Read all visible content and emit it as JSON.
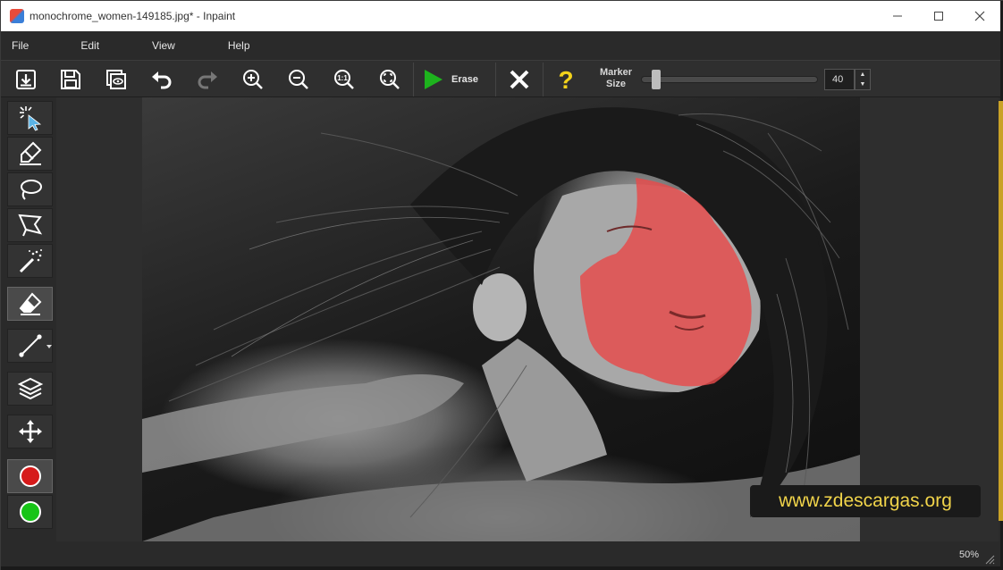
{
  "window": {
    "title": "monochrome_women-149185.jpg* - Inpaint",
    "minimize_icon": "minimize-icon",
    "maximize_icon": "maximize-icon",
    "close_icon": "close-icon"
  },
  "menu": {
    "items": [
      {
        "label": "File"
      },
      {
        "label": "Edit"
      },
      {
        "label": "View"
      },
      {
        "label": "Help"
      }
    ]
  },
  "toolbar": {
    "open_icon": "open-icon",
    "save_icon": "save-icon",
    "compare_icon": "compare-icon",
    "undo_icon": "undo-icon",
    "redo_icon": "redo-icon",
    "zoom_in_icon": "zoom-in-icon",
    "zoom_out_icon": "zoom-out-icon",
    "zoom_actual_icon": "zoom-actual-icon",
    "zoom_fit_icon": "zoom-fit-icon",
    "erase_label": "Erase",
    "cancel_icon": "cancel-icon",
    "help_icon": "help-icon",
    "marker_label_line1": "Marker",
    "marker_label_line2": "Size",
    "marker_size_value": "40",
    "marker_size_min": 1,
    "marker_size_max": 400
  },
  "tools": [
    {
      "name": "selection-tool",
      "icon": "cursor-icon"
    },
    {
      "name": "marker-tool",
      "icon": "marker-icon"
    },
    {
      "name": "lasso-tool",
      "icon": "lasso-icon"
    },
    {
      "name": "polygonal-lasso-tool",
      "icon": "polygon-lasso-icon"
    },
    {
      "name": "magic-wand-tool",
      "icon": "magic-wand-icon"
    },
    {
      "name": "eraser-tool",
      "icon": "eraser-icon",
      "active": true
    },
    {
      "name": "guide-lines-tool",
      "icon": "line-icon"
    },
    {
      "name": "multi-view-tool",
      "icon": "layers-icon"
    },
    {
      "name": "move-tool",
      "icon": "move-icon"
    },
    {
      "name": "red-mask-color",
      "icon": "red-circle-icon"
    },
    {
      "name": "green-mask-color",
      "icon": "green-circle-icon"
    }
  ],
  "colors": {
    "erase_green": "#1db31d",
    "mask_red": "#e84a4a",
    "help_yellow": "#f2d21b",
    "watermark_yellow": "#f1d44a"
  },
  "canvas": {
    "watermark": "www.zdescargas.org"
  },
  "status": {
    "zoom": "50%"
  }
}
